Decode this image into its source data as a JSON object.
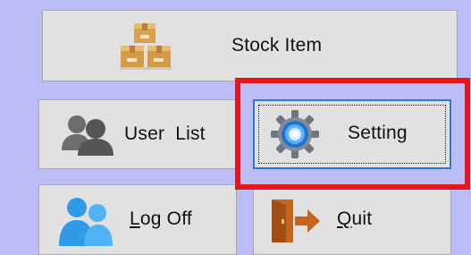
{
  "menu": {
    "stock_item": {
      "label": "Stock Item",
      "icon": "boxes-icon"
    },
    "user_list": {
      "label": "User  List",
      "icon": "users-icon"
    },
    "setting": {
      "label": "Setting",
      "icon": "gear-icon"
    },
    "log_off": {
      "label_mnemonic": "L",
      "label_rest": "og Off",
      "icon": "people-logoff-icon"
    },
    "quit": {
      "label_mnemonic": "Q",
      "label_rest": "uit",
      "icon": "exit-door-icon"
    }
  },
  "colors": {
    "panel_background": "#bcbcf6",
    "button_face": "#e1e1e1",
    "focused_button_border": "#2a79d6",
    "highlight_annotation": "#e8141b"
  }
}
